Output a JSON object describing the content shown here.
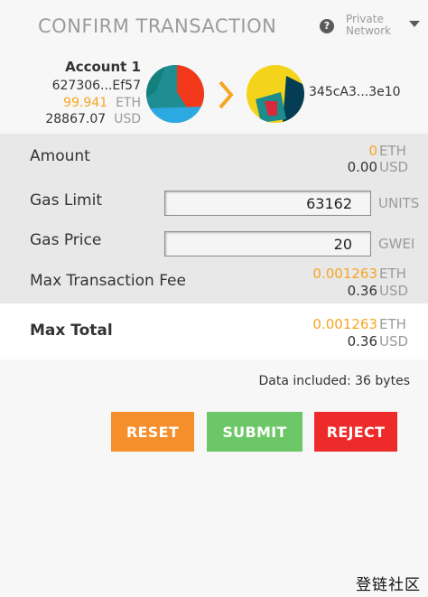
{
  "header": {
    "title": "CONFIRM TRANSACTION",
    "help_glyph": "?",
    "network_line1": "Private",
    "network_line2": "Network"
  },
  "from_account": {
    "name": "Account 1",
    "address": "627306...Ef57",
    "eth_balance": "99.941",
    "eth_unit": "ETH",
    "usd_balance": "28867.07",
    "usd_unit": "USD"
  },
  "to_account": {
    "address": "345cA3...3e10"
  },
  "details": {
    "amount_label": "Amount",
    "amount_eth": "0",
    "amount_eth_unit": "ETH",
    "amount_usd": "0.00",
    "amount_usd_unit": "USD",
    "gas_limit_label": "Gas Limit",
    "gas_limit_value": "63162",
    "gas_limit_unit": "UNITS",
    "gas_price_label": "Gas Price",
    "gas_price_value": "20",
    "gas_price_unit": "GWEI",
    "max_fee_label": "Max Transaction Fee",
    "max_fee_eth": "0.001263",
    "max_fee_eth_unit": "ETH",
    "max_fee_usd": "0.36",
    "max_fee_usd_unit": "USD"
  },
  "total": {
    "label": "Max Total",
    "eth": "0.001263",
    "eth_unit": "ETH",
    "usd": "0.36",
    "usd_unit": "USD"
  },
  "data_included": "Data included: 36 bytes",
  "buttons": {
    "reset": "RESET",
    "submit": "SUBMIT",
    "reject": "REJECT"
  },
  "watermark": "登链社区",
  "icons": {
    "help": "help-icon",
    "network_dropdown": "caret-down-icon",
    "transfer_arrow": "chevron-right-icon",
    "from_identicon": "identicon",
    "to_identicon": "identicon"
  },
  "colors": {
    "accent_orange": "#f5a623",
    "reset": "#f48f2b",
    "submit": "#6cc766",
    "reject": "#ee2b2b",
    "muted": "#9b9b9b"
  }
}
